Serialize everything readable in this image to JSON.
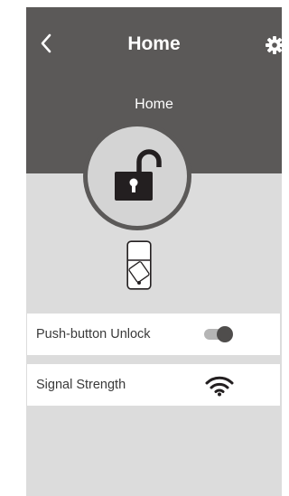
{
  "nav": {
    "title": "Home",
    "back_icon": "chevron-left-icon",
    "settings_icon": "gear-icon"
  },
  "lock": {
    "name": "Home",
    "state_icon": "unlocked-padlock-icon"
  },
  "device": {
    "icon": "lock-device-icon"
  },
  "settings": [
    {
      "label": "Push-button Unlock",
      "control": "toggle",
      "enabled": true
    },
    {
      "label": "Signal Strength",
      "control": "wifi-signal-icon"
    }
  ],
  "colors": {
    "header": "#5b5958",
    "background": "#dcdcdc",
    "row_background": "#ffffff",
    "icon_dark": "#231f20"
  }
}
